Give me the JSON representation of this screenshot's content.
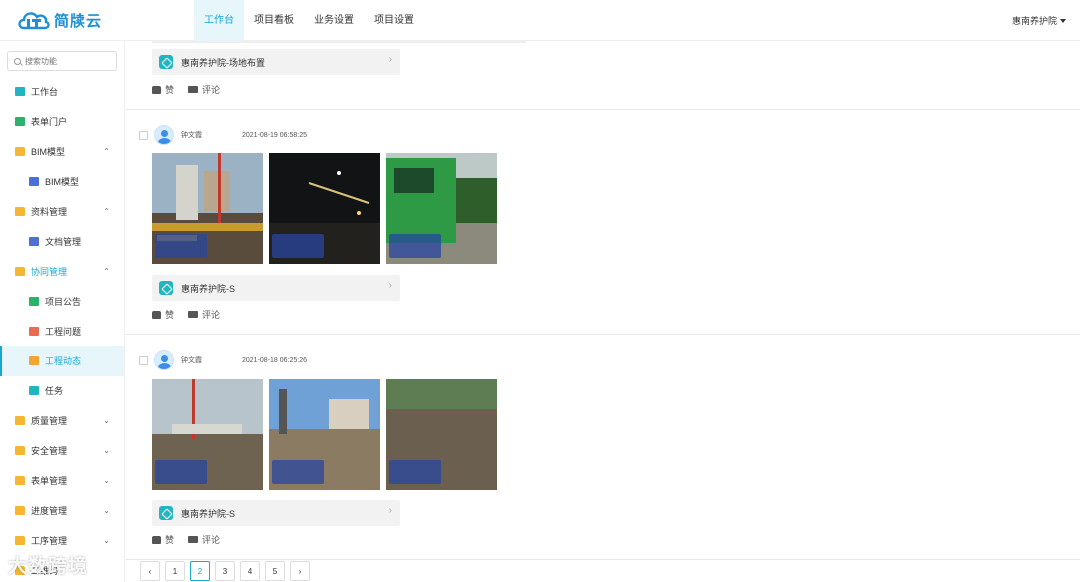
{
  "brand": {
    "name": "简牍云"
  },
  "topnav": [
    {
      "label": "工作台",
      "active": true
    },
    {
      "label": "项目看板",
      "active": false
    },
    {
      "label": "业务设置",
      "active": false
    },
    {
      "label": "项目设置",
      "active": false
    }
  ],
  "user": {
    "name": "惠南养护院"
  },
  "sidebar": {
    "search_placeholder": "搜索功能",
    "items": [
      {
        "label": "工作台",
        "icon": "workbench-icon"
      },
      {
        "label": "表单门户",
        "icon": "form-portal-icon"
      },
      {
        "label": "BIM模型",
        "icon": "folder-icon",
        "chevron": "⌃"
      },
      {
        "label": "BIM模型",
        "icon": "bim-icon",
        "sub": true
      },
      {
        "label": "资料管理",
        "icon": "folder-icon",
        "chevron": "⌃"
      },
      {
        "label": "文档管理",
        "icon": "document-icon",
        "sub": true
      },
      {
        "label": "协同管理",
        "icon": "folder-icon",
        "chevron": "⌃",
        "highlight": true
      },
      {
        "label": "项目公告",
        "icon": "announcement-icon",
        "sub": true
      },
      {
        "label": "工程问题",
        "icon": "issue-icon",
        "sub": true
      },
      {
        "label": "工程动态",
        "icon": "dynamic-icon",
        "sub": true,
        "active": true
      },
      {
        "label": "任务",
        "icon": "task-icon",
        "sub": true
      },
      {
        "label": "质量管理",
        "icon": "folder-icon",
        "chevron": "⌄"
      },
      {
        "label": "安全管理",
        "icon": "folder-icon",
        "chevron": "⌄"
      },
      {
        "label": "表单管理",
        "icon": "folder-icon",
        "chevron": "⌄"
      },
      {
        "label": "进度管理",
        "icon": "folder-icon",
        "chevron": "⌄"
      },
      {
        "label": "工序管理",
        "icon": "folder-icon",
        "chevron": "⌄"
      },
      {
        "label": "二维码",
        "icon": "folder-icon"
      }
    ]
  },
  "feed": {
    "top_post": {
      "project": "惠南养护院-场地布置",
      "like": "赞",
      "comment": "评论"
    },
    "posts": [
      {
        "author": "钟文霞",
        "time": "2021-08-19 06:58:25",
        "project": "惠南养护院-S",
        "like": "赞",
        "comment": "评论"
      },
      {
        "author": "钟文霞",
        "time": "2021-08-18 06:25:26",
        "project": "惠南养护院-S",
        "like": "赞",
        "comment": "评论"
      }
    ]
  },
  "pagination": {
    "prev": "‹",
    "pages": [
      "1",
      "2",
      "3",
      "4",
      "5"
    ],
    "current": "2",
    "next": "›"
  },
  "watermark": "大数跨境",
  "colors": {
    "accent": "#19a7d4",
    "brand": "#1d8fd8",
    "folder": "#f5b731"
  }
}
